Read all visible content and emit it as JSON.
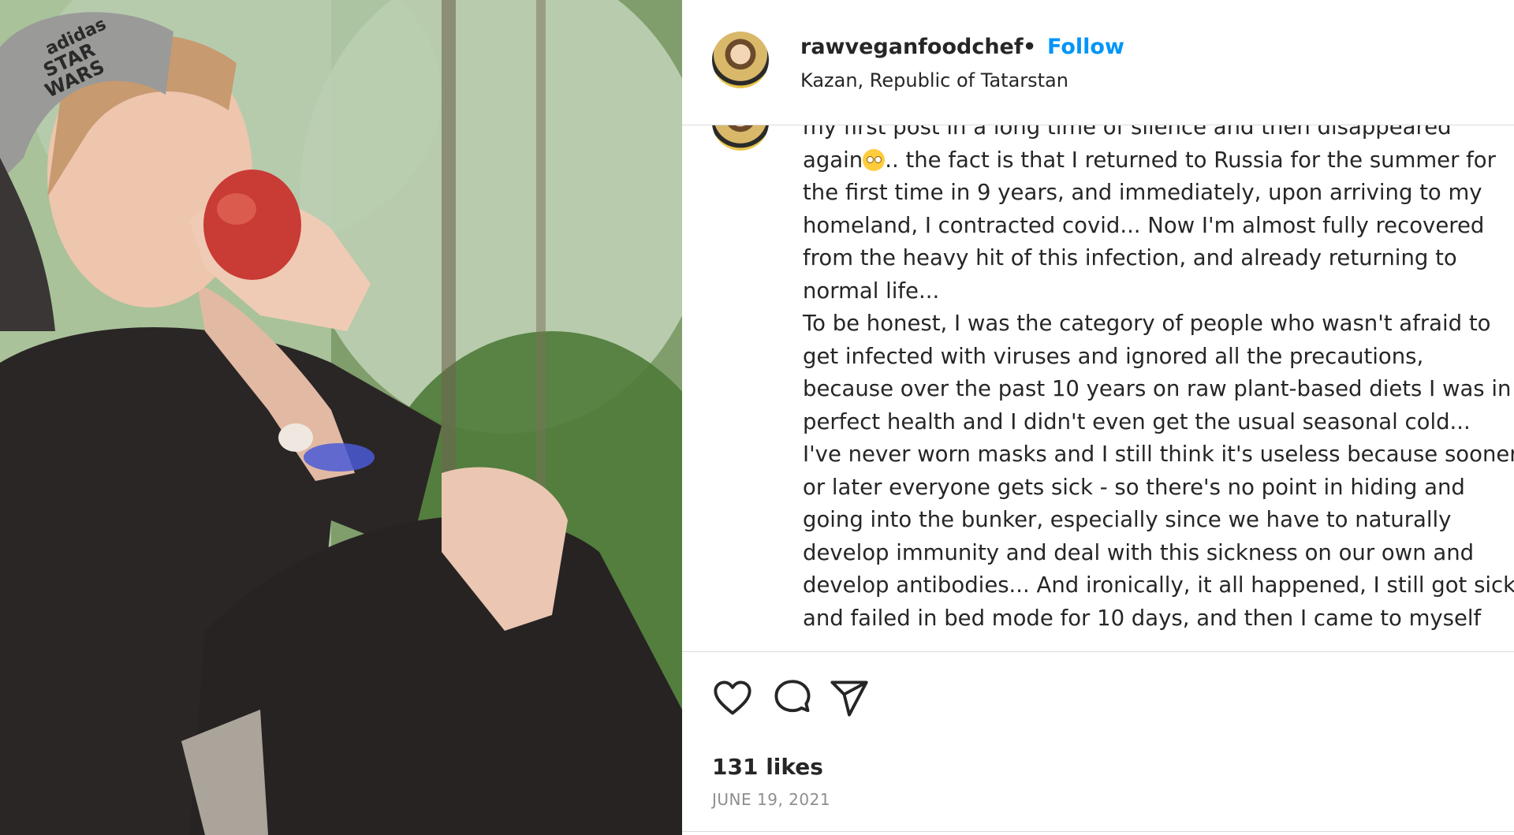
{
  "post": {
    "username": "rawveganfoodchef",
    "separator": "•",
    "follow_label": "Follow",
    "location": "Kazan, Republic of Tatarstan",
    "caption_lines": [
      "my first post in a long time of silence and then disappeared",
      ".. the fact is that I returned to Russia for the summer for",
      "the first time in 9 years, and immediately, upon arriving to my",
      "homeland, I contracted covid... Now I'm almost fully recovered",
      "from the heavy hit of this infection, and already returning to",
      "normal life...",
      "To be honest, I was the category of people who wasn't afraid to",
      "get infected with viruses and ignored all the precautions,",
      "because over the past 10 years on raw plant-based diets I was in",
      "perfect health and I didn't even get the usual seasonal cold...",
      "I've never worn masks and I still think it's useless because sooner",
      "or later everyone gets sick - so there's no point in hiding and",
      "going into the bunker, especially since we have to naturally",
      "develop immunity and deal with this sickness on our own and",
      "develop antibodies... And ironically, it all happened, I still got sick",
      "and failed in bed mode for 10 days, and then I came to myself"
    ],
    "caption_line2_prefix": "again",
    "likes": "131 likes",
    "date": "JUNE 19, 2021",
    "photo_cap_text": "adidas STAR WARS"
  },
  "icons": {
    "like": "heart-icon",
    "comment": "comment-icon",
    "share": "share-icon",
    "emoji": "eye-roll-emoji"
  },
  "colors": {
    "follow": "#0095f6",
    "text": "#262626",
    "muted": "#8e8e8e",
    "border": "#dbdbdb"
  }
}
